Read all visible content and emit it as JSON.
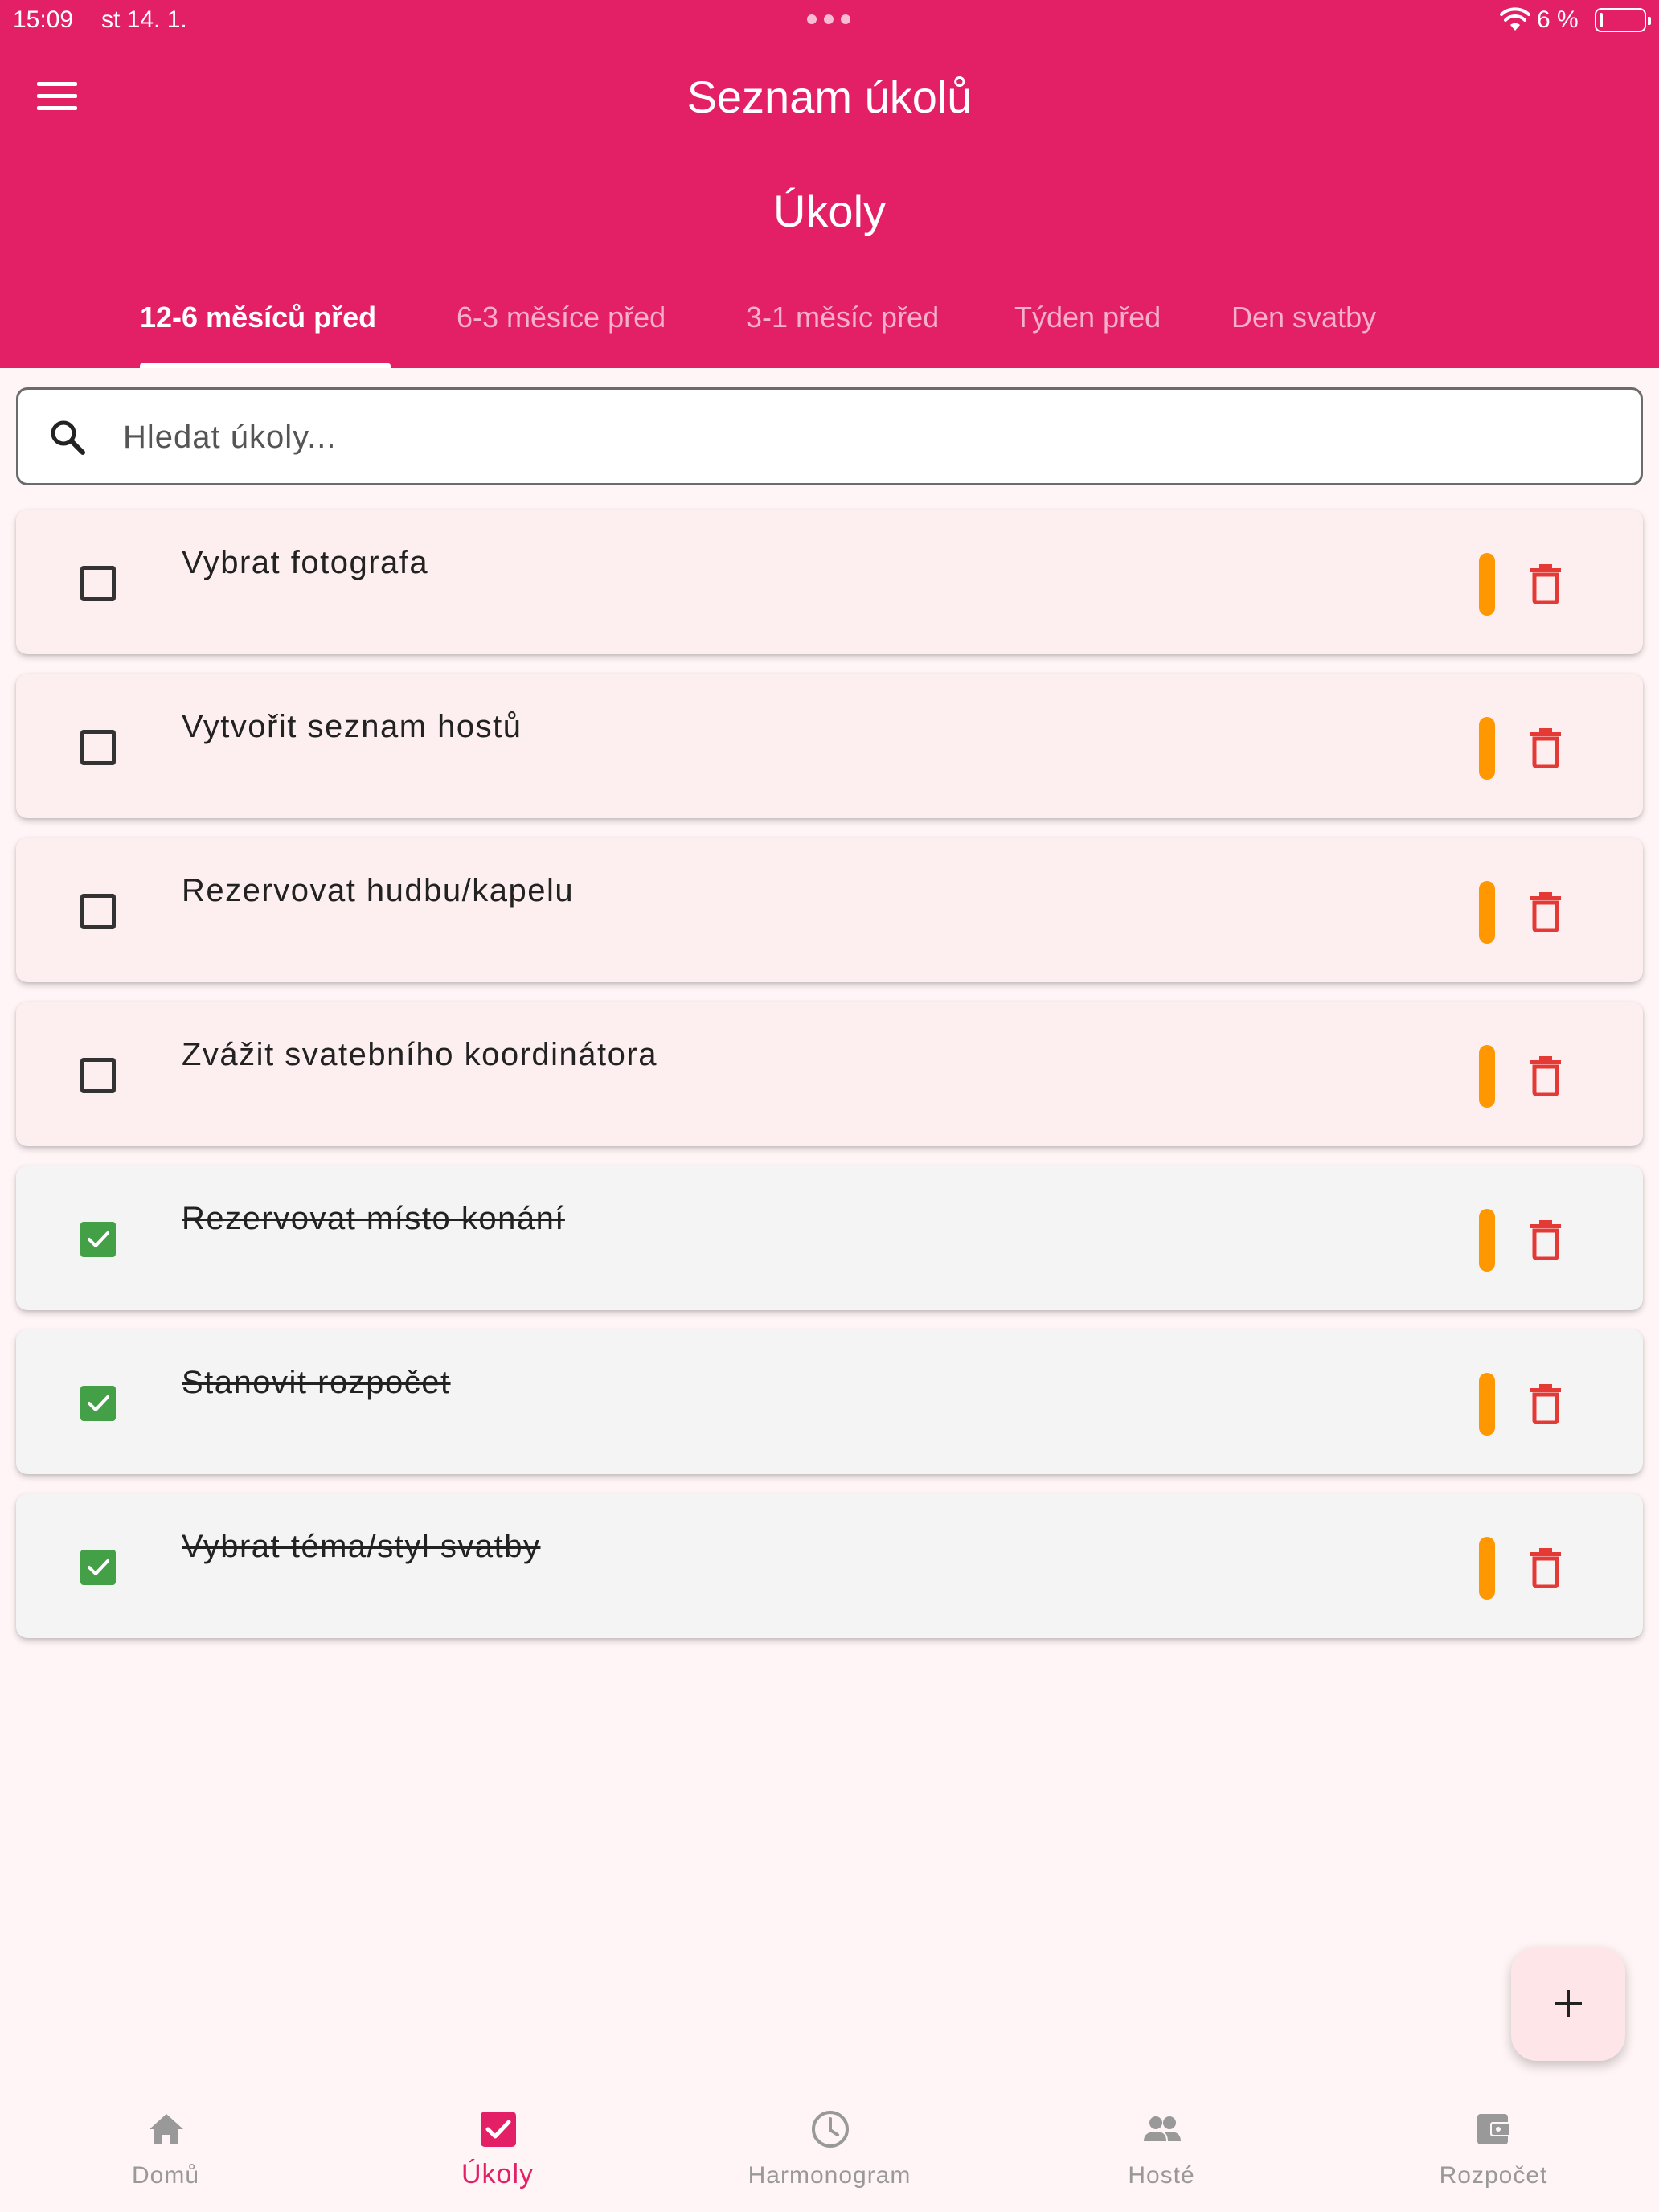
{
  "status_bar": {
    "time": "15:09",
    "date": "st 14. 1.",
    "battery": "6 %"
  },
  "app_bar": {
    "title": "Seznam úkolů",
    "menu_icon": "hamburger-menu-icon"
  },
  "page": {
    "heading": "Úkoly"
  },
  "tabs": [
    {
      "label": "12-6 měsíců před",
      "active": true
    },
    {
      "label": "6-3 měsíce před",
      "active": false
    },
    {
      "label": "3-1 měsíc před",
      "active": false
    },
    {
      "label": "Týden před",
      "active": false
    },
    {
      "label": "Den svatby",
      "active": false
    }
  ],
  "search": {
    "placeholder": "Hledat úkoly...",
    "value": "",
    "icon": "search-icon"
  },
  "tasks": [
    {
      "title": "Vybrat fotografa",
      "done": false
    },
    {
      "title": "Vytvořit seznam hostů",
      "done": false
    },
    {
      "title": "Rezervovat hudbu/kapelu",
      "done": false
    },
    {
      "title": "Zvážit svatebního koordinátora",
      "done": false
    },
    {
      "title": "Rezervovat místo konání",
      "done": true
    },
    {
      "title": "Stanovit rozpočet",
      "done": true
    },
    {
      "title": "Vybrat téma/styl svatby",
      "done": true
    }
  ],
  "fab": {
    "icon": "plus-icon"
  },
  "bottom_nav": [
    {
      "label": "Domů",
      "icon": "home-icon",
      "active": false
    },
    {
      "label": "Úkoly",
      "icon": "checkbox-icon",
      "active": true
    },
    {
      "label": "Harmonogram",
      "icon": "clock-icon",
      "active": false
    },
    {
      "label": "Hosté",
      "icon": "people-icon",
      "active": false
    },
    {
      "label": "Rozpočet",
      "icon": "wallet-icon",
      "active": false
    }
  ],
  "colors": {
    "primary": "#e32066",
    "priority": "#ff9800",
    "delete": "#e53935",
    "checked": "#43a047",
    "pending_card": "#fdeff0",
    "done_card": "#f5f4f5",
    "background": "#fff5f6"
  }
}
